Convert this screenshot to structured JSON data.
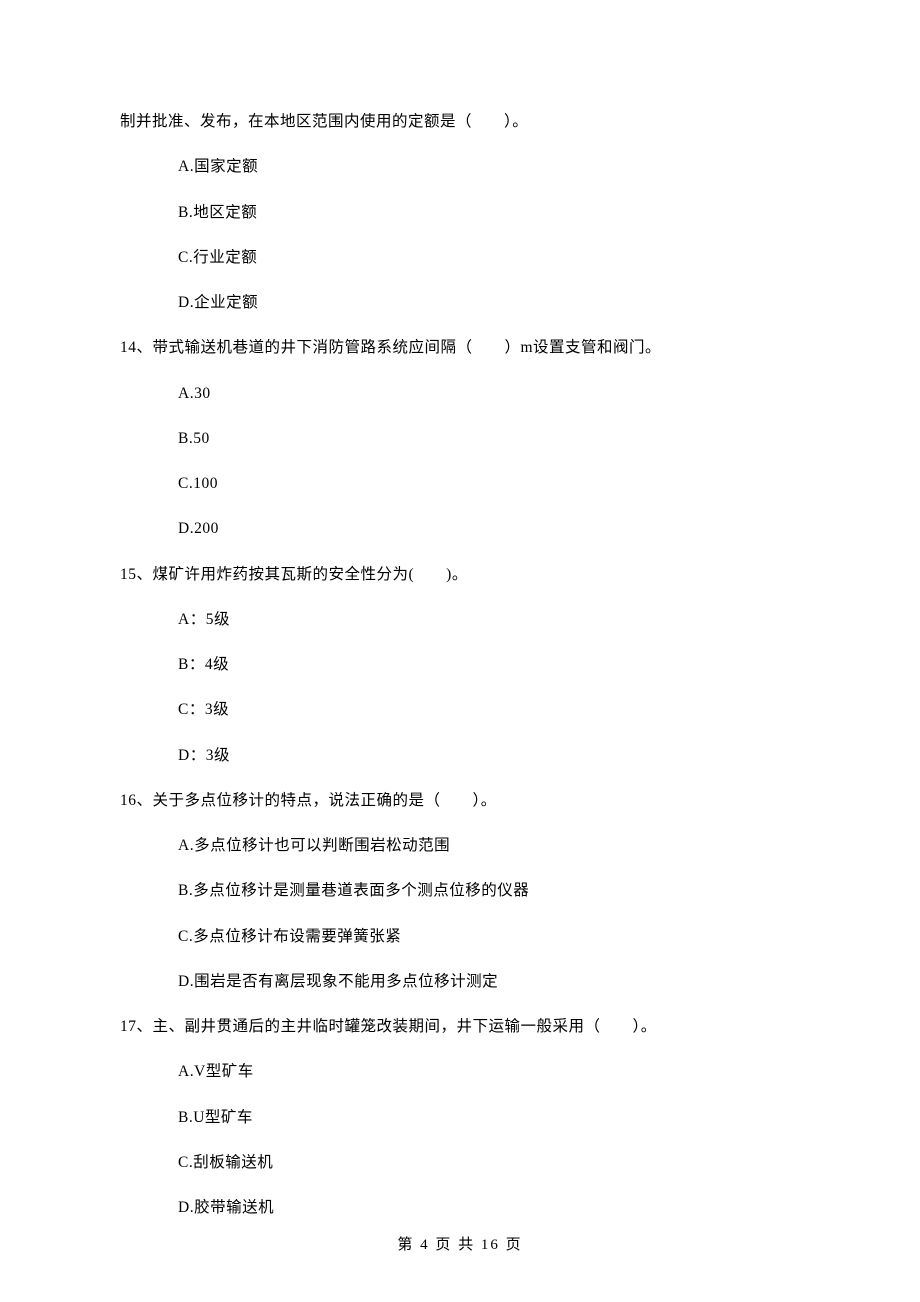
{
  "top_line": "制并批准、发布，在本地区范围内使用的定额是（　　）。",
  "top_options": {
    "A": "A.国家定额",
    "B": "B.地区定额",
    "C": "C.行业定额",
    "D": "D.企业定额"
  },
  "q14": {
    "stem": "14、带式输送机巷道的井下消防管路系统应间隔（　　）m设置支管和阀门。",
    "A": "A.30",
    "B": "B.50",
    "C": "C.100",
    "D": "D.200"
  },
  "q15": {
    "stem": "15、煤矿许用炸药按其瓦斯的安全性分为(　　)。",
    "A": "A：5级",
    "B": "B：4级",
    "C": "C：3级",
    "D": "D：3级"
  },
  "q16": {
    "stem": "16、关于多点位移计的特点，说法正确的是（　　）。",
    "A": "A.多点位移计也可以判断围岩松动范围",
    "B": "B.多点位移计是测量巷道表面多个测点位移的仪器",
    "C": "C.多点位移计布设需要弹簧张紧",
    "D": "D.围岩是否有离层现象不能用多点位移计测定"
  },
  "q17": {
    "stem": "17、主、副井贯通后的主井临时罐笼改装期间，井下运输一般采用（　　）。",
    "A": "A.V型矿车",
    "B": "B.U型矿车",
    "C": "C.刮板输送机",
    "D": "D.胶带输送机"
  },
  "footer": "第 4 页 共 16 页"
}
